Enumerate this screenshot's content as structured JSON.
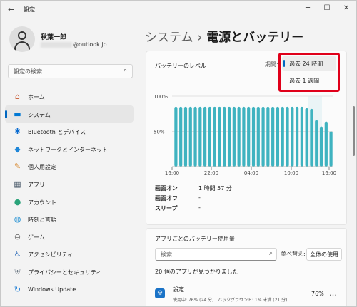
{
  "window": {
    "title": "設定",
    "back_icon": "back-arrow-icon",
    "minimize_glyph": "─",
    "maximize_glyph": "☐",
    "close_glyph": "✕"
  },
  "user": {
    "name": "秋葉一郎",
    "email_suffix": "@outlook.jp"
  },
  "search": {
    "placeholder": "設定の検索",
    "icon": "search-icon"
  },
  "nav": {
    "items": [
      {
        "label": "ホーム",
        "icon": "home-icon",
        "glyph": "⌂",
        "color": "#c8562e"
      },
      {
        "label": "システム",
        "icon": "monitor-icon",
        "glyph": "▬",
        "color": "#0078d4",
        "selected": true
      },
      {
        "label": "Bluetooth とデバイス",
        "icon": "bluetooth-icon",
        "glyph": "✱",
        "color": "#0a6cd1"
      },
      {
        "label": "ネットワークとインターネット",
        "icon": "wifi-icon",
        "glyph": "◆",
        "color": "#1e86d8"
      },
      {
        "label": "個人用設定",
        "icon": "brush-icon",
        "glyph": "✎",
        "color": "#d68326"
      },
      {
        "label": "アプリ",
        "icon": "apps-icon",
        "glyph": "▦",
        "color": "#4a5a6a"
      },
      {
        "label": "アカウント",
        "icon": "account-icon",
        "glyph": "●",
        "color": "#2aa37a"
      },
      {
        "label": "時刻と言語",
        "icon": "globe-clock-icon",
        "glyph": "◍",
        "color": "#1f8fd2"
      },
      {
        "label": "ゲーム",
        "icon": "gamepad-icon",
        "glyph": "⊜",
        "color": "#6b6b6b"
      },
      {
        "label": "アクセシビリティ",
        "icon": "accessibility-icon",
        "glyph": "♿",
        "color": "#1a5fb4"
      },
      {
        "label": "プライバシーとセキュリティ",
        "icon": "shield-icon",
        "glyph": "⛨",
        "color": "#6f7b86"
      },
      {
        "label": "Windows Update",
        "icon": "update-icon",
        "glyph": "↻",
        "color": "#1f7fd6"
      }
    ]
  },
  "header": {
    "breadcrumb_root": "システム",
    "separator": "›",
    "current": "電源とバッテリー"
  },
  "battery": {
    "title": "バッテリーのレベル",
    "period_label": "期間:",
    "accent_color": "#3fb3c0",
    "y_ticks": [
      "100%",
      "50%"
    ],
    "x_ticks": [
      "16:00",
      "22:00",
      "04:00",
      "10:00",
      "16:00"
    ],
    "stats": [
      {
        "label": "画面オン",
        "value": "1 時間 57 分"
      },
      {
        "label": "画面オフ",
        "value": "-"
      },
      {
        "label": "スリープ",
        "value": "-"
      }
    ]
  },
  "period_dropdown": {
    "options": [
      {
        "label": "過去 24 時間",
        "selected": true
      },
      {
        "label": "過去 1 週間",
        "selected": false
      }
    ],
    "highlight_color": "#e0001a"
  },
  "apps_usage": {
    "title": "アプリごとのバッテリー使用量",
    "search_placeholder": "検索",
    "sort_label": "並べ替え:",
    "sort_value": "全体の使用",
    "count_text": "20 個のアプリが見つかりました",
    "rows": [
      {
        "name": "設定",
        "detail": "使用中: 76% (24 分) | バックグラウンド: 1% 未満 (21 分)",
        "percent": "76%",
        "icon": "settings-gear-icon",
        "more": "…"
      }
    ]
  },
  "chart_data": {
    "type": "bar",
    "title": "バッテリーのレベル",
    "xlabel": "",
    "ylabel": "",
    "ylim": [
      0,
      100
    ],
    "x_tick_labels": [
      "16:00",
      "22:00",
      "04:00",
      "10:00",
      "16:00"
    ],
    "y_tick_labels": [
      "100%",
      "50%"
    ],
    "grid": true,
    "values": [
      85,
      85,
      85,
      85,
      85,
      85,
      85,
      85,
      85,
      85,
      85,
      85,
      85,
      85,
      85,
      85,
      85,
      85,
      85,
      85,
      85,
      85,
      85,
      85,
      85,
      85,
      85,
      83,
      82,
      66,
      57,
      64,
      50
    ]
  }
}
